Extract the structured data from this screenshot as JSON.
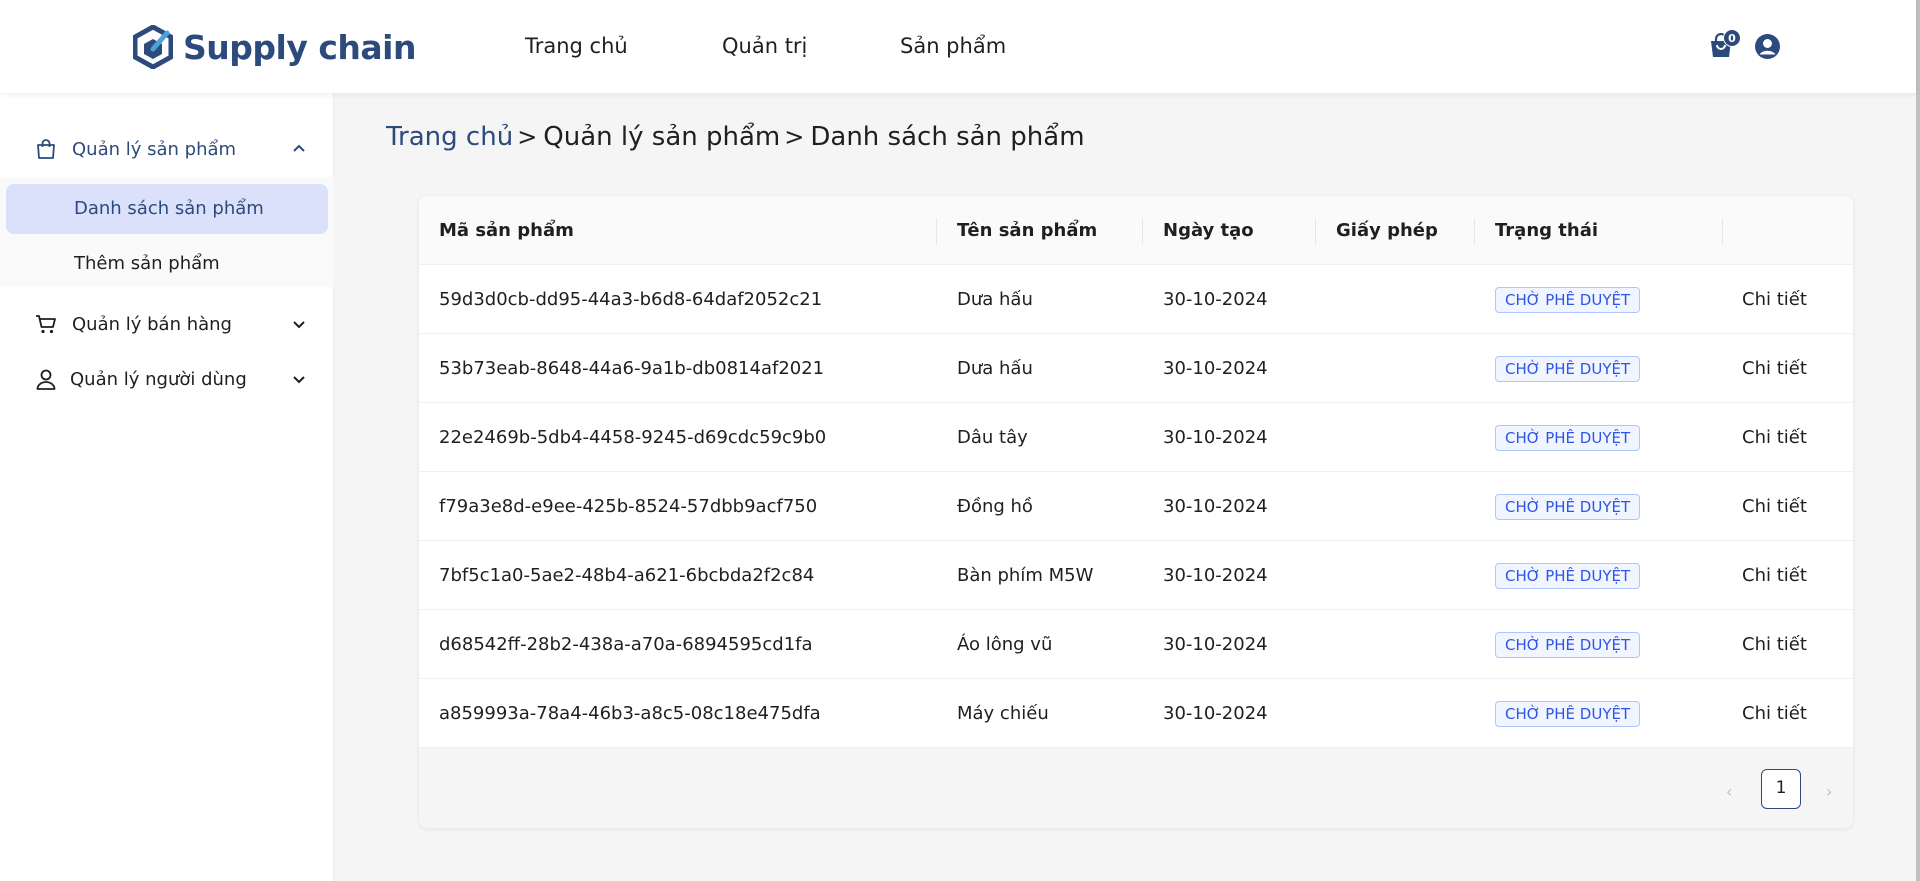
{
  "header": {
    "brand": "Supply chain",
    "nav": [
      "Trang chủ",
      "Quản trị",
      "Sản phẩm"
    ],
    "cart_count": "0",
    "accent_color": "#2d4a7c"
  },
  "sidebar": {
    "groups": [
      {
        "label": "Quản lý sản phẩm",
        "icon": "shopping-bag-icon",
        "expanded": true,
        "items": [
          "Danh sách sản phẩm",
          "Thêm sản phẩm"
        ],
        "active": "Danh sách sản phẩm"
      },
      {
        "label": "Quản lý bán hàng",
        "icon": "cart-icon",
        "expanded": false
      },
      {
        "label": "Quản lý người dùng",
        "icon": "user-icon",
        "expanded": false
      }
    ]
  },
  "breadcrumb": {
    "home": "Trang chủ",
    "sep": ">",
    "items": [
      "Quản lý sản phẩm",
      "Danh sách sản phẩm"
    ]
  },
  "table": {
    "columns": [
      "Mã sản phẩm",
      "Tên sản phẩm",
      "Ngày tạo",
      "Giấy phép",
      "Trạng thái"
    ],
    "rows": [
      {
        "id": "59d3d0cb-dd95-44a3-b6d8-64daf2052c21",
        "name": "Dưa hấu",
        "date": "30-10-2024",
        "license": "",
        "status": "CHỜ PHÊ DUYỆT",
        "action": "Chi tiết"
      },
      {
        "id": "53b73eab-8648-44a6-9a1b-db0814af2021",
        "name": "Dưa hấu",
        "date": "30-10-2024",
        "license": "",
        "status": "CHỜ PHÊ DUYỆT",
        "action": "Chi tiết"
      },
      {
        "id": "22e2469b-5db4-4458-9245-d69cdc59c9b0",
        "name": "Dâu tây",
        "date": "30-10-2024",
        "license": "",
        "status": "CHỜ PHÊ DUYỆT",
        "action": "Chi tiết"
      },
      {
        "id": "f79a3e8d-e9ee-425b-8524-57dbb9acf750",
        "name": "Đồng hồ",
        "date": "30-10-2024",
        "license": "",
        "status": "CHỜ PHÊ DUYỆT",
        "action": "Chi tiết"
      },
      {
        "id": "7bf5c1a0-5ae2-48b4-a621-6bcbda2f2c84",
        "name": "Bàn phím M5W",
        "date": "30-10-2024",
        "license": "",
        "status": "CHỜ PHÊ DUYỆT",
        "action": "Chi tiết"
      },
      {
        "id": "d68542ff-28b2-438a-a70a-6894595cd1fa",
        "name": "Áo lông vũ",
        "date": "30-10-2024",
        "license": "",
        "status": "CHỜ PHÊ DUYỆT",
        "action": "Chi tiết"
      },
      {
        "id": "a859993a-78a4-46b3-a8c5-08c18e475dfa",
        "name": "Máy chiếu",
        "date": "30-10-2024",
        "license": "",
        "status": "CHỜ PHÊ DUYỆT",
        "action": "Chi tiết"
      }
    ]
  },
  "pagination": {
    "current": "1",
    "prev_icon": "chevron-left-icon",
    "next_icon": "chevron-right-icon"
  }
}
